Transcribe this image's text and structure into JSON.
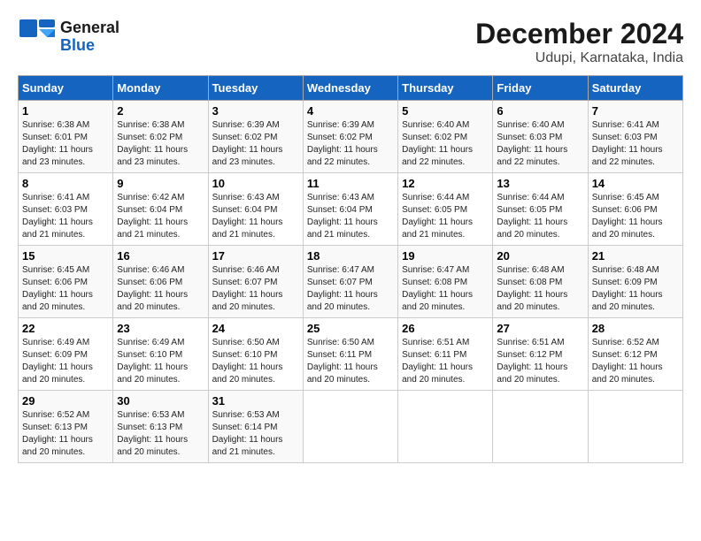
{
  "header": {
    "logo_line1": "General",
    "logo_line2": "Blue",
    "title": "December 2024",
    "subtitle": "Udupi, Karnataka, India"
  },
  "weekdays": [
    "Sunday",
    "Monday",
    "Tuesday",
    "Wednesday",
    "Thursday",
    "Friday",
    "Saturday"
  ],
  "weeks": [
    [
      {
        "day": "1",
        "sunrise": "6:38 AM",
        "sunset": "6:01 PM",
        "daylight": "11 hours and 23 minutes."
      },
      {
        "day": "2",
        "sunrise": "6:38 AM",
        "sunset": "6:02 PM",
        "daylight": "11 hours and 23 minutes."
      },
      {
        "day": "3",
        "sunrise": "6:39 AM",
        "sunset": "6:02 PM",
        "daylight": "11 hours and 23 minutes."
      },
      {
        "day": "4",
        "sunrise": "6:39 AM",
        "sunset": "6:02 PM",
        "daylight": "11 hours and 22 minutes."
      },
      {
        "day": "5",
        "sunrise": "6:40 AM",
        "sunset": "6:02 PM",
        "daylight": "11 hours and 22 minutes."
      },
      {
        "day": "6",
        "sunrise": "6:40 AM",
        "sunset": "6:03 PM",
        "daylight": "11 hours and 22 minutes."
      },
      {
        "day": "7",
        "sunrise": "6:41 AM",
        "sunset": "6:03 PM",
        "daylight": "11 hours and 22 minutes."
      }
    ],
    [
      {
        "day": "8",
        "sunrise": "6:41 AM",
        "sunset": "6:03 PM",
        "daylight": "11 hours and 21 minutes."
      },
      {
        "day": "9",
        "sunrise": "6:42 AM",
        "sunset": "6:04 PM",
        "daylight": "11 hours and 21 minutes."
      },
      {
        "day": "10",
        "sunrise": "6:43 AM",
        "sunset": "6:04 PM",
        "daylight": "11 hours and 21 minutes."
      },
      {
        "day": "11",
        "sunrise": "6:43 AM",
        "sunset": "6:04 PM",
        "daylight": "11 hours and 21 minutes."
      },
      {
        "day": "12",
        "sunrise": "6:44 AM",
        "sunset": "6:05 PM",
        "daylight": "11 hours and 21 minutes."
      },
      {
        "day": "13",
        "sunrise": "6:44 AM",
        "sunset": "6:05 PM",
        "daylight": "11 hours and 20 minutes."
      },
      {
        "day": "14",
        "sunrise": "6:45 AM",
        "sunset": "6:06 PM",
        "daylight": "11 hours and 20 minutes."
      }
    ],
    [
      {
        "day": "15",
        "sunrise": "6:45 AM",
        "sunset": "6:06 PM",
        "daylight": "11 hours and 20 minutes."
      },
      {
        "day": "16",
        "sunrise": "6:46 AM",
        "sunset": "6:06 PM",
        "daylight": "11 hours and 20 minutes."
      },
      {
        "day": "17",
        "sunrise": "6:46 AM",
        "sunset": "6:07 PM",
        "daylight": "11 hours and 20 minutes."
      },
      {
        "day": "18",
        "sunrise": "6:47 AM",
        "sunset": "6:07 PM",
        "daylight": "11 hours and 20 minutes."
      },
      {
        "day": "19",
        "sunrise": "6:47 AM",
        "sunset": "6:08 PM",
        "daylight": "11 hours and 20 minutes."
      },
      {
        "day": "20",
        "sunrise": "6:48 AM",
        "sunset": "6:08 PM",
        "daylight": "11 hours and 20 minutes."
      },
      {
        "day": "21",
        "sunrise": "6:48 AM",
        "sunset": "6:09 PM",
        "daylight": "11 hours and 20 minutes."
      }
    ],
    [
      {
        "day": "22",
        "sunrise": "6:49 AM",
        "sunset": "6:09 PM",
        "daylight": "11 hours and 20 minutes."
      },
      {
        "day": "23",
        "sunrise": "6:49 AM",
        "sunset": "6:10 PM",
        "daylight": "11 hours and 20 minutes."
      },
      {
        "day": "24",
        "sunrise": "6:50 AM",
        "sunset": "6:10 PM",
        "daylight": "11 hours and 20 minutes."
      },
      {
        "day": "25",
        "sunrise": "6:50 AM",
        "sunset": "6:11 PM",
        "daylight": "11 hours and 20 minutes."
      },
      {
        "day": "26",
        "sunrise": "6:51 AM",
        "sunset": "6:11 PM",
        "daylight": "11 hours and 20 minutes."
      },
      {
        "day": "27",
        "sunrise": "6:51 AM",
        "sunset": "6:12 PM",
        "daylight": "11 hours and 20 minutes."
      },
      {
        "day": "28",
        "sunrise": "6:52 AM",
        "sunset": "6:12 PM",
        "daylight": "11 hours and 20 minutes."
      }
    ],
    [
      {
        "day": "29",
        "sunrise": "6:52 AM",
        "sunset": "6:13 PM",
        "daylight": "11 hours and 20 minutes."
      },
      {
        "day": "30",
        "sunrise": "6:53 AM",
        "sunset": "6:13 PM",
        "daylight": "11 hours and 20 minutes."
      },
      {
        "day": "31",
        "sunrise": "6:53 AM",
        "sunset": "6:14 PM",
        "daylight": "11 hours and 21 minutes."
      },
      null,
      null,
      null,
      null
    ]
  ]
}
